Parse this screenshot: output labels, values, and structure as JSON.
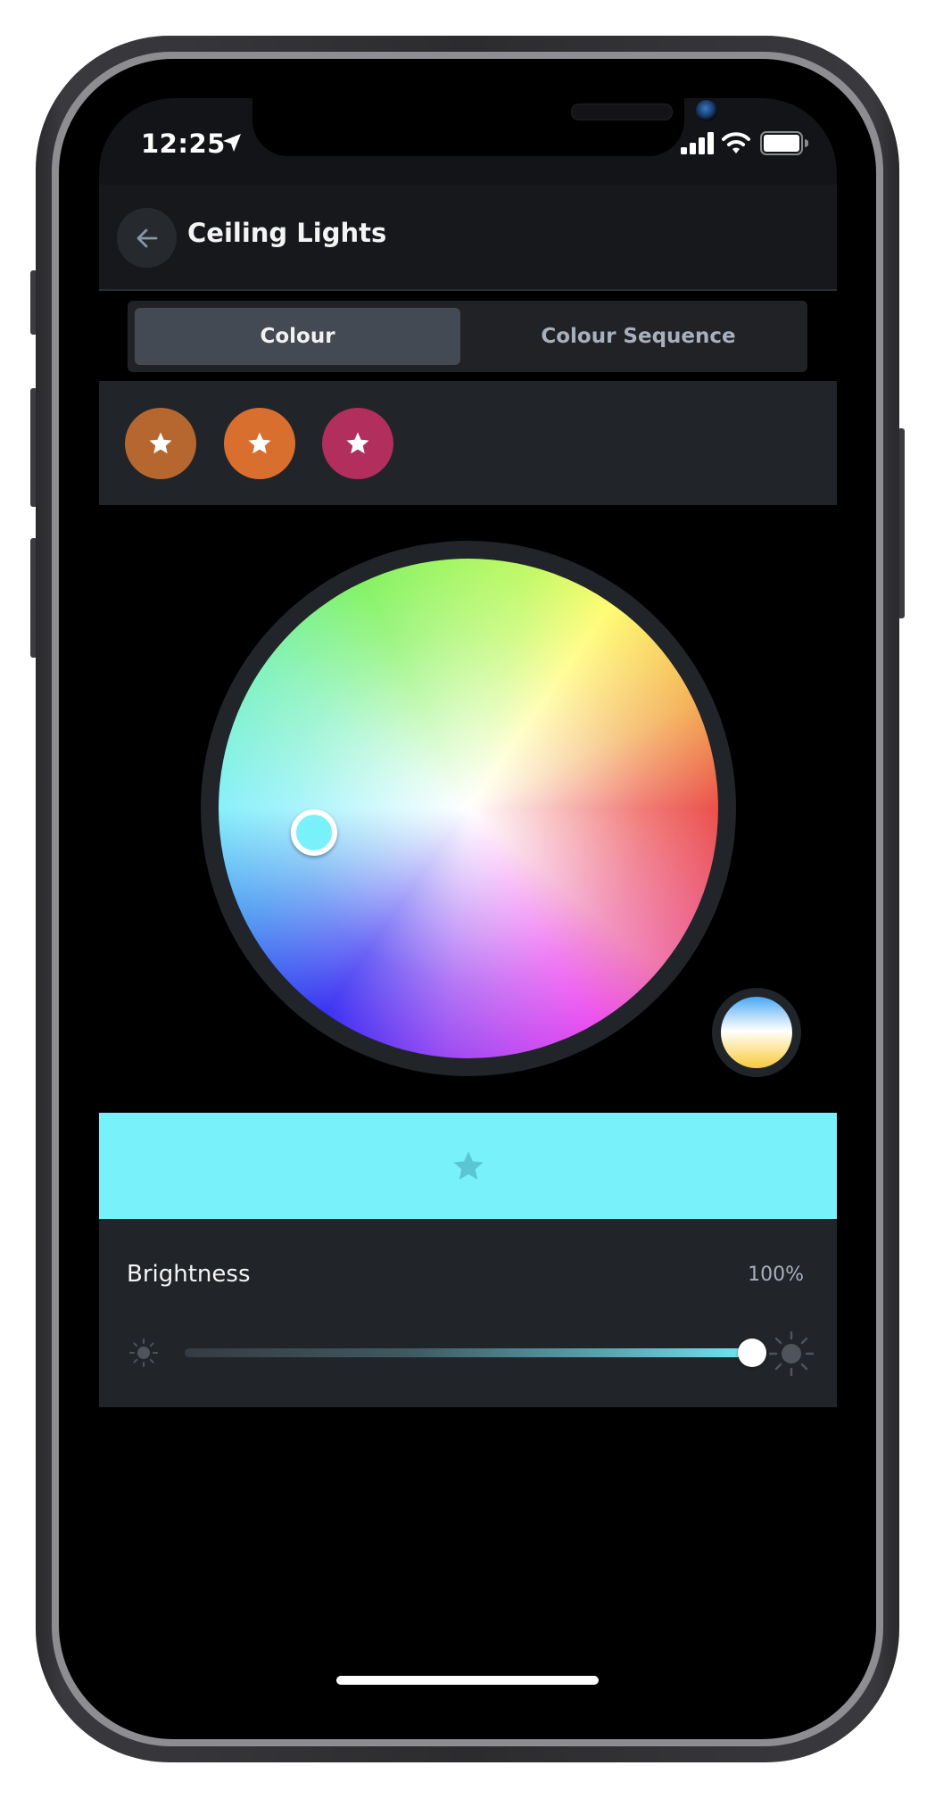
{
  "status_bar": {
    "time": "12:25",
    "location_icon": "location-arrow-icon",
    "signal_icon": "cellular-signal-icon",
    "wifi_icon": "wifi-icon",
    "battery_icon": "battery-icon"
  },
  "header": {
    "back_icon": "arrow-left-icon",
    "title": "Ceiling Lights"
  },
  "tabs": [
    {
      "label": "Colour",
      "active": true
    },
    {
      "label": "Colour Sequence",
      "active": false
    }
  ],
  "favorites": [
    {
      "icon": "star-icon",
      "color": "#b5672f"
    },
    {
      "icon": "star-icon",
      "color": "#d86f2f"
    },
    {
      "icon": "star-icon",
      "color": "#b22e5c"
    }
  ],
  "color_wheel": {
    "selected_color": "#78f1fa",
    "white_mode_icon": "white-temperature-icon"
  },
  "selected_color_bar": {
    "color": "#78f1fa",
    "icon": "star-icon",
    "icon_color": "#5cc5d2"
  },
  "brightness": {
    "label": "Brightness",
    "value_text": "100%",
    "value_percent": 100,
    "min_icon": "sun-dim-icon",
    "max_icon": "sun-bright-icon"
  }
}
